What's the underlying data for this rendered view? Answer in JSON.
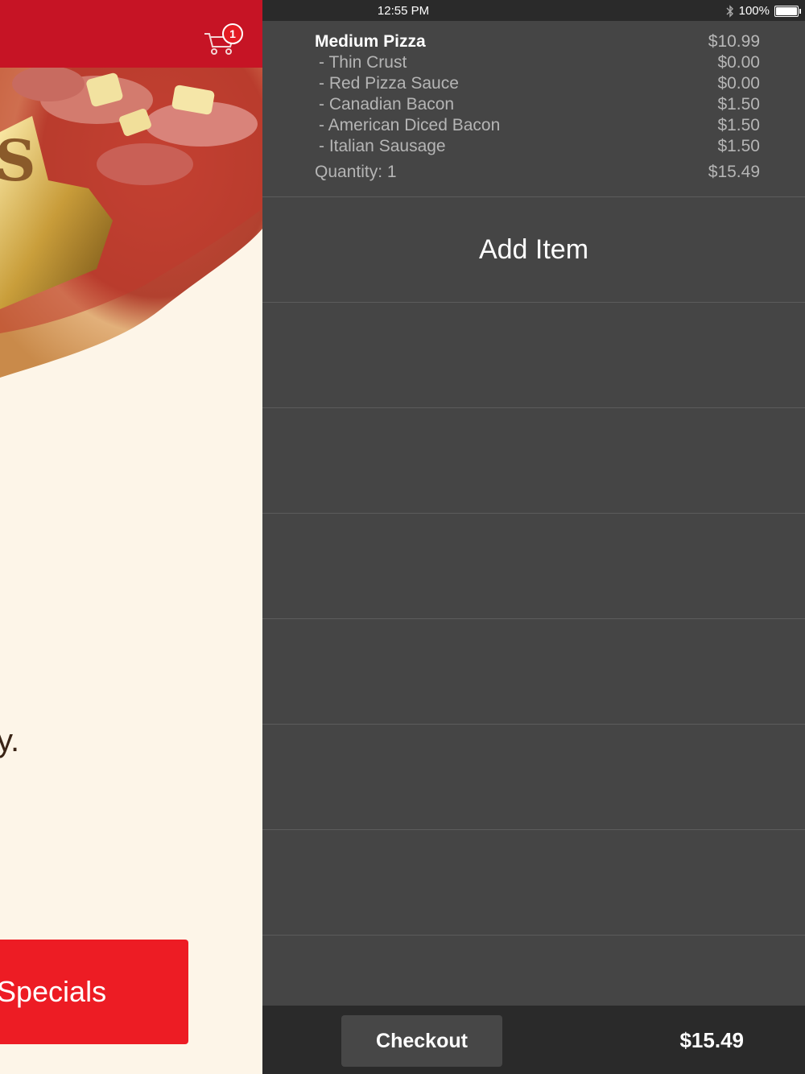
{
  "status_bar": {
    "time": "12:55 PM",
    "battery": "100%",
    "bluetooth_icon": "bluetooth-icon"
  },
  "left_panel": {
    "cart_badge_count": "1",
    "partial_text": "y.",
    "specials_label": "Specials",
    "colors": {
      "header": "#c61425",
      "background": "#fdf5e8",
      "button": "#ed1c24"
    }
  },
  "order": {
    "item_name": "Medium Pizza",
    "item_price": "$10.99",
    "modifiers": [
      {
        "label": "- Thin Crust",
        "price": "$0.00"
      },
      {
        "label": "- Red Pizza Sauce",
        "price": "$0.00"
      },
      {
        "label": "- Canadian Bacon",
        "price": "$1.50"
      },
      {
        "label": "- American Diced Bacon",
        "price": "$1.50"
      },
      {
        "label": "- Italian Sausage",
        "price": "$1.50"
      }
    ],
    "quantity_label": "Quantity: 1",
    "line_total": "$15.49"
  },
  "add_item_label": "Add Item",
  "footer": {
    "checkout_label": "Checkout",
    "total": "$15.49"
  }
}
